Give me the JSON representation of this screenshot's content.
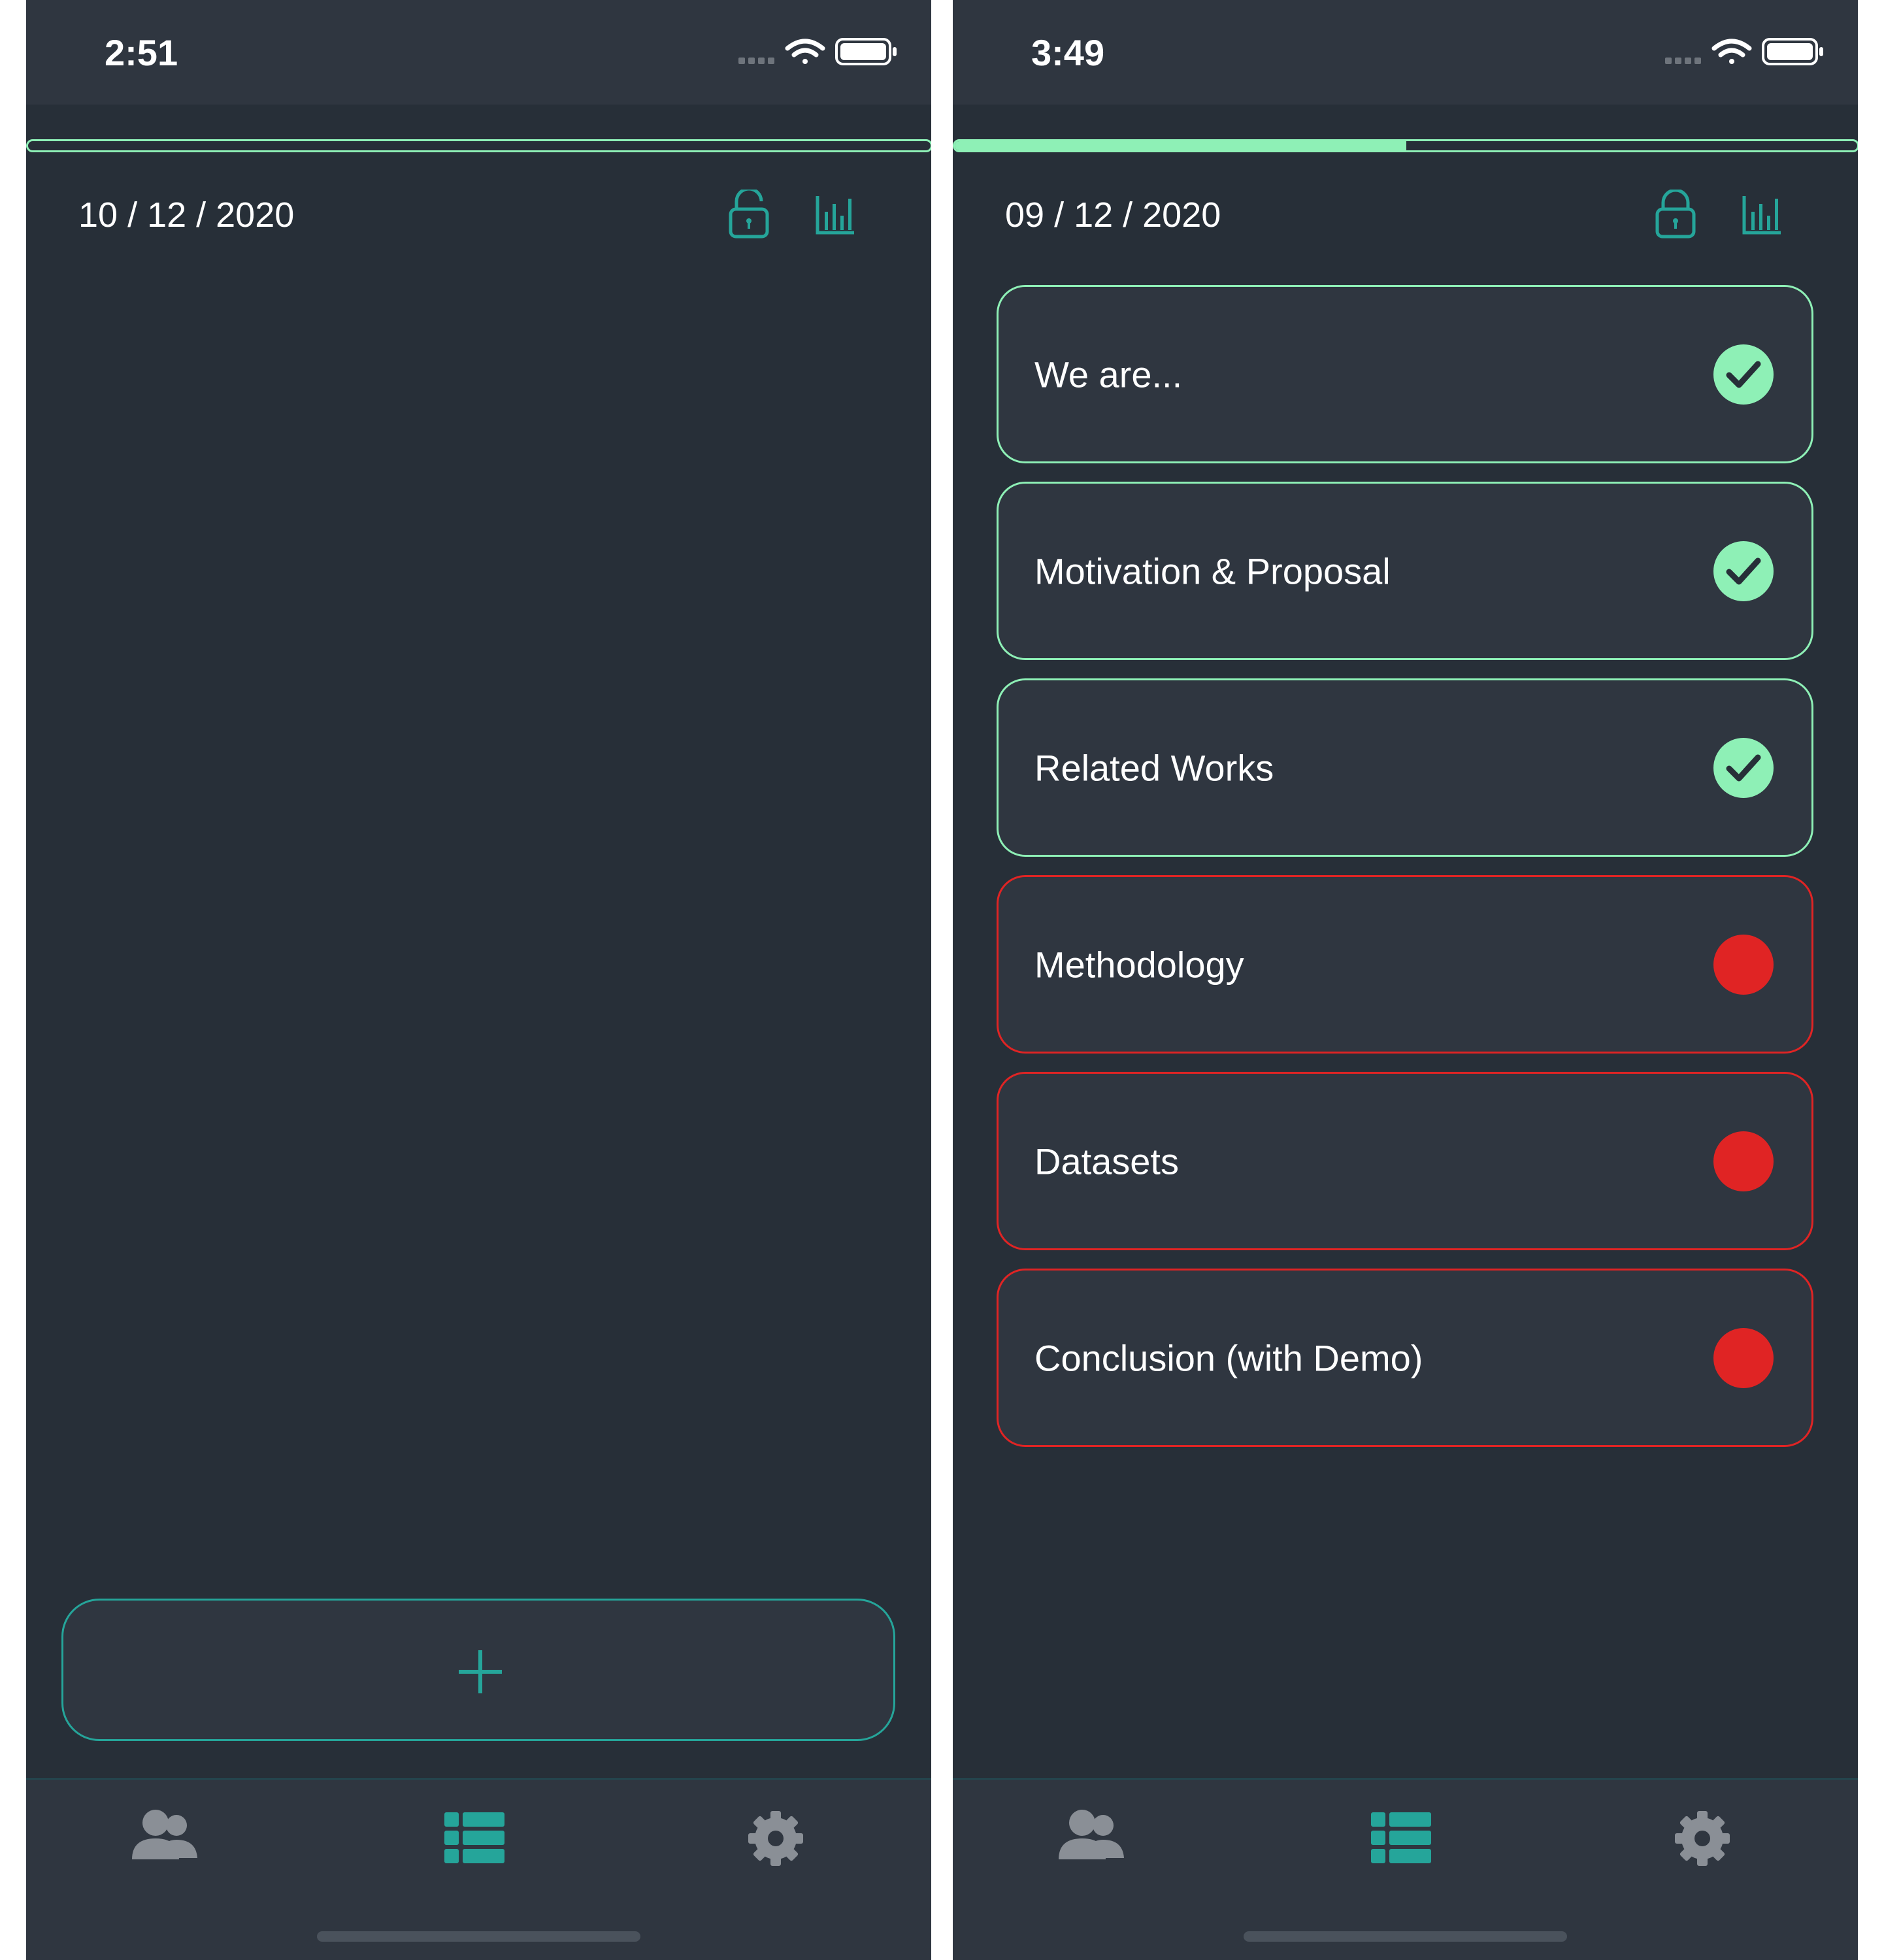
{
  "colors": {
    "accent": "#8ef0b6",
    "teal": "#25a59a",
    "pending_red": "#e02424",
    "background": "#272f38",
    "surface": "#2f3640"
  },
  "screens": [
    {
      "status_bar": {
        "time": "2:51"
      },
      "progress": 0,
      "date": "10 / 12 / 2020",
      "header_icons": [
        "lock-open-icon",
        "bar-chart-icon"
      ],
      "tasks": [],
      "add_button_icon": "plus-icon",
      "tab_bar": {
        "items": [
          "contacts-icon",
          "list-icon",
          "gear-icon"
        ],
        "active": "list-icon"
      }
    },
    {
      "status_bar": {
        "time": "3:49"
      },
      "progress": 0.5,
      "date": "09 / 12 / 2020",
      "header_icons": [
        "lock-closed-icon",
        "bar-chart-icon"
      ],
      "tasks": [
        {
          "title": "We are...",
          "status": "done"
        },
        {
          "title": "Motivation & Proposal",
          "status": "done"
        },
        {
          "title": "Related Works",
          "status": "done"
        },
        {
          "title": "Methodology",
          "status": "pending"
        },
        {
          "title": "Datasets",
          "status": "pending"
        },
        {
          "title": "Conclusion (with Demo)",
          "status": "pending"
        }
      ],
      "tab_bar": {
        "items": [
          "contacts-icon",
          "list-icon",
          "gear-icon"
        ],
        "active": "list-icon"
      }
    }
  ]
}
